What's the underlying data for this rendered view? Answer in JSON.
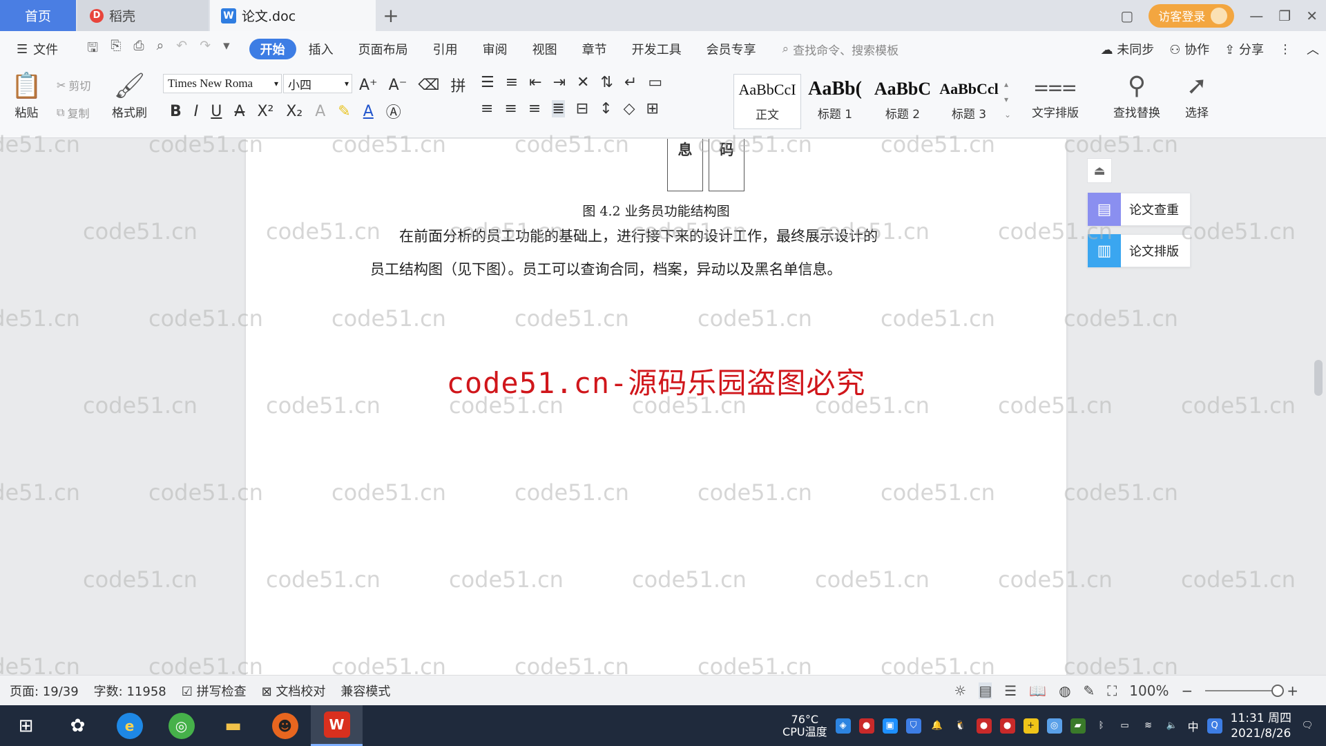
{
  "tabs": {
    "home": "首页",
    "daoke": "稻壳",
    "doc": "论文.doc",
    "add": "+",
    "guest_login": "访客登录"
  },
  "menu": {
    "file": "文件",
    "tabs": [
      "开始",
      "插入",
      "页面布局",
      "引用",
      "审阅",
      "视图",
      "章节",
      "开发工具",
      "会员专享"
    ],
    "search_placeholder": "查找命令、搜索模板",
    "sync": "未同步",
    "collab": "协作",
    "share": "分享"
  },
  "ribbon": {
    "paste": "粘贴",
    "cut": "剪切",
    "copy": "复制",
    "format_painter": "格式刷",
    "font_name": "Times New Roma",
    "font_size": "小四",
    "styles": [
      {
        "sample": "AaBbCcI",
        "name": "正文"
      },
      {
        "sample": "AaBb(",
        "name": "标题 1"
      },
      {
        "sample": "AaBbC",
        "name": "标题 2"
      },
      {
        "sample": "AaBbCcl",
        "name": "标题 3"
      }
    ],
    "text_layout": "文字排版",
    "find_replace": "查找替换",
    "select": "选择"
  },
  "document": {
    "chart_boxes": [
      "息",
      "码"
    ],
    "caption": "图 4.2  业务员功能结构图",
    "para_line1": "在前面分析的员工功能的基础上，进行接下来的设计工作，最终展示设计的",
    "para_line2": "员工结构图（见下图）。员工可以查询合同，档案，异动以及黑名单信息。",
    "red_watermark": "code51.cn-源码乐园盗图必究",
    "watermark": "code51.cn"
  },
  "side_panel": {
    "check": "论文查重",
    "layout": "论文排版"
  },
  "status": {
    "page": "页面: 19/39",
    "words": "字数: 11958",
    "spell": "拼写检查",
    "proof": "文档校对",
    "compat": "兼容模式",
    "zoom": "100%"
  },
  "taskbar": {
    "cpu_temp": "76°C",
    "cpu_label": "CPU温度",
    "time": "11:31 周四",
    "date": "2021/8/26",
    "ime": "中"
  }
}
